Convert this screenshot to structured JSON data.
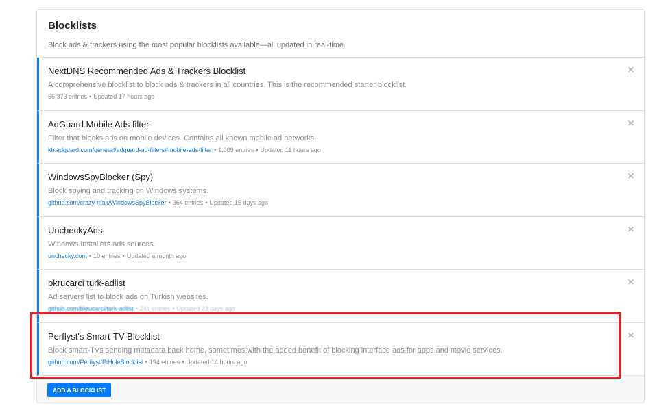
{
  "header": {
    "title": "Blocklists",
    "subtitle": "Block ads & trackers using the most popular blocklists available—all updated in real-time."
  },
  "items": [
    {
      "name": "NextDNS Recommended Ads & Trackers Blocklist",
      "description": "A comprehensive blocklist to block ads & trackers in all countries. This is the recommended starter blocklist.",
      "link": "",
      "entries": "66,373 entries",
      "updated": "Updated 17 hours ago"
    },
    {
      "name": "AdGuard Mobile Ads filter",
      "description": "Filter that blocks ads on mobile devices. Contains all known mobile ad networks.",
      "link": "kb.adguard.com/general/adguard-ad-filters#mobile-ads-filter",
      "entries": "1,009 entries",
      "updated": "Updated 11 hours ago"
    },
    {
      "name": "WindowsSpyBlocker (Spy)",
      "description": "Block spying and tracking on Windows systems.",
      "link": "github.com/crazy-max/WindowsSpyBlocker",
      "entries": "364 entries",
      "updated": "Updated 15 days ago"
    },
    {
      "name": "UncheckyAds",
      "description": "Windows installers ads sources.",
      "link": "unchecky.com",
      "entries": "10 entries",
      "updated": "Updated a month ago"
    },
    {
      "name": "bkrucarci turk-adlist",
      "description": "Ad servers list to block ads on Turkish websites.",
      "link": "github.com/bkrucarci/turk-adlist",
      "entries": "241 entries",
      "updated": "Updated 23 days ago"
    },
    {
      "name": "Perflyst's Smart-TV Blocklist",
      "description": "Block smart-TVs sending metadata back home, sometimes with the added benefit of blocking interface ads for apps and movie services.",
      "link": "github.com/Perflyst/PiHoleBlocklist",
      "entries": "194 entries",
      "updated": "Updated 14 hours ago"
    }
  ],
  "close_symbol": "×",
  "separator": "•",
  "footer": {
    "add_button_label": "ADD A BLOCKLIST"
  },
  "colors": {
    "accent": "#1a82e2",
    "button": "#007bff",
    "highlight": "#e0242b"
  }
}
